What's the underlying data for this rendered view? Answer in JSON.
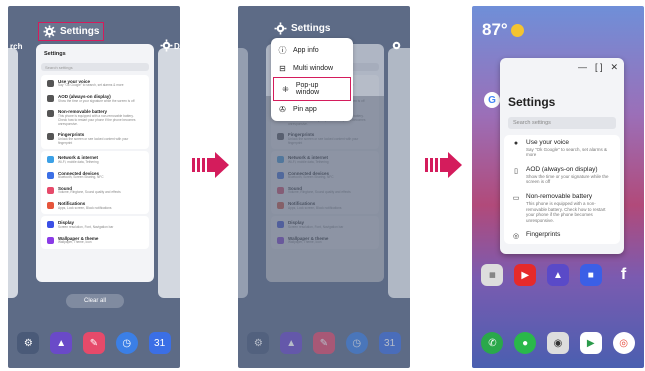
{
  "colors": {
    "highlight": "#d41c5c",
    "arrow": "#d41c5c",
    "recents_bg": "#5d6b86"
  },
  "step1": {
    "left_partial_text": "rch",
    "right_partial_icon": "gear-icon",
    "right_partial_text": "D",
    "app_title": "Settings",
    "card": {
      "header": "Settings",
      "search_placeholder": "Search settings",
      "group1": [
        {
          "title": "Use your voice",
          "subtitle": "Say \"Ok Google\" to search, set alarms & more",
          "icon": "mic-icon",
          "color": "#555555"
        },
        {
          "title": "AOD (always-on display)",
          "subtitle": "Show the time or your signature while the screen is off",
          "icon": "phone-icon",
          "color": "#555555"
        },
        {
          "title": "Non-removable battery",
          "subtitle": "This phone is equipped with a non-removable battery. Check how to restart your phone if the phone becomes unresponsive.",
          "icon": "battery-icon",
          "color": "#555555"
        },
        {
          "title": "Fingerprints",
          "subtitle": "Unlock the screen or see locked content with your fingerprint",
          "icon": "fingerprint-icon",
          "color": "#555555"
        }
      ],
      "group2": [
        {
          "title": "Network & internet",
          "subtitle": "Wi-Fi, mobile data, Tethering",
          "icon": "wifi-icon",
          "color": "#3ba0e6"
        },
        {
          "title": "Connected devices",
          "subtitle": "Bluetooth, Screen Sharing, NFC",
          "icon": "devices-icon",
          "color": "#3b6fe6"
        },
        {
          "title": "Sound",
          "subtitle": "Volume, Ringtone, Sound quality and effects",
          "icon": "sound-icon",
          "color": "#e64a6a"
        },
        {
          "title": "Notifications",
          "subtitle": "Apps, Lock screen, Block notifications",
          "icon": "bell-icon",
          "color": "#e6553b"
        }
      ],
      "group3": [
        {
          "title": "Display",
          "subtitle": "Screen resolution, Font, Navigation bar",
          "icon": "display-icon",
          "color": "#3b4fe6"
        },
        {
          "title": "Wallpaper & theme",
          "subtitle": "Wallpaper, Theme, Icon",
          "icon": "palette-icon",
          "color": "#8a3be6"
        }
      ]
    },
    "clear_all": "Clear all"
  },
  "step2": {
    "app_title": "Settings",
    "menu": [
      {
        "label": "App info",
        "icon": "info-icon"
      },
      {
        "label": "Multi window",
        "icon": "split-icon"
      },
      {
        "label": "Pop-up window",
        "icon": "popup-icon"
      },
      {
        "label": "Pin app",
        "icon": "pin-icon"
      }
    ]
  },
  "step3": {
    "temperature": "87°",
    "popup": {
      "controls": [
        "—",
        "[ ]",
        "✕"
      ],
      "title": "Settings",
      "search_placeholder": "Search settings",
      "rows": [
        {
          "title": "Use your voice",
          "subtitle": "Say \"Ok Google\" to search, set alarms & more",
          "icon": "mic-icon"
        },
        {
          "title": "AOD (always-on display)",
          "subtitle": "Show the time or your signature while the screen is off",
          "icon": "phone-icon"
        },
        {
          "title": "Non-removable battery",
          "subtitle": "This phone is equipped with a non-removable battery. Check how to restart your phone if the phone becomes unresponsive.",
          "icon": "battery-icon"
        },
        {
          "title": "Fingerprints",
          "subtitle": "",
          "icon": "fingerprint-icon"
        }
      ]
    }
  }
}
